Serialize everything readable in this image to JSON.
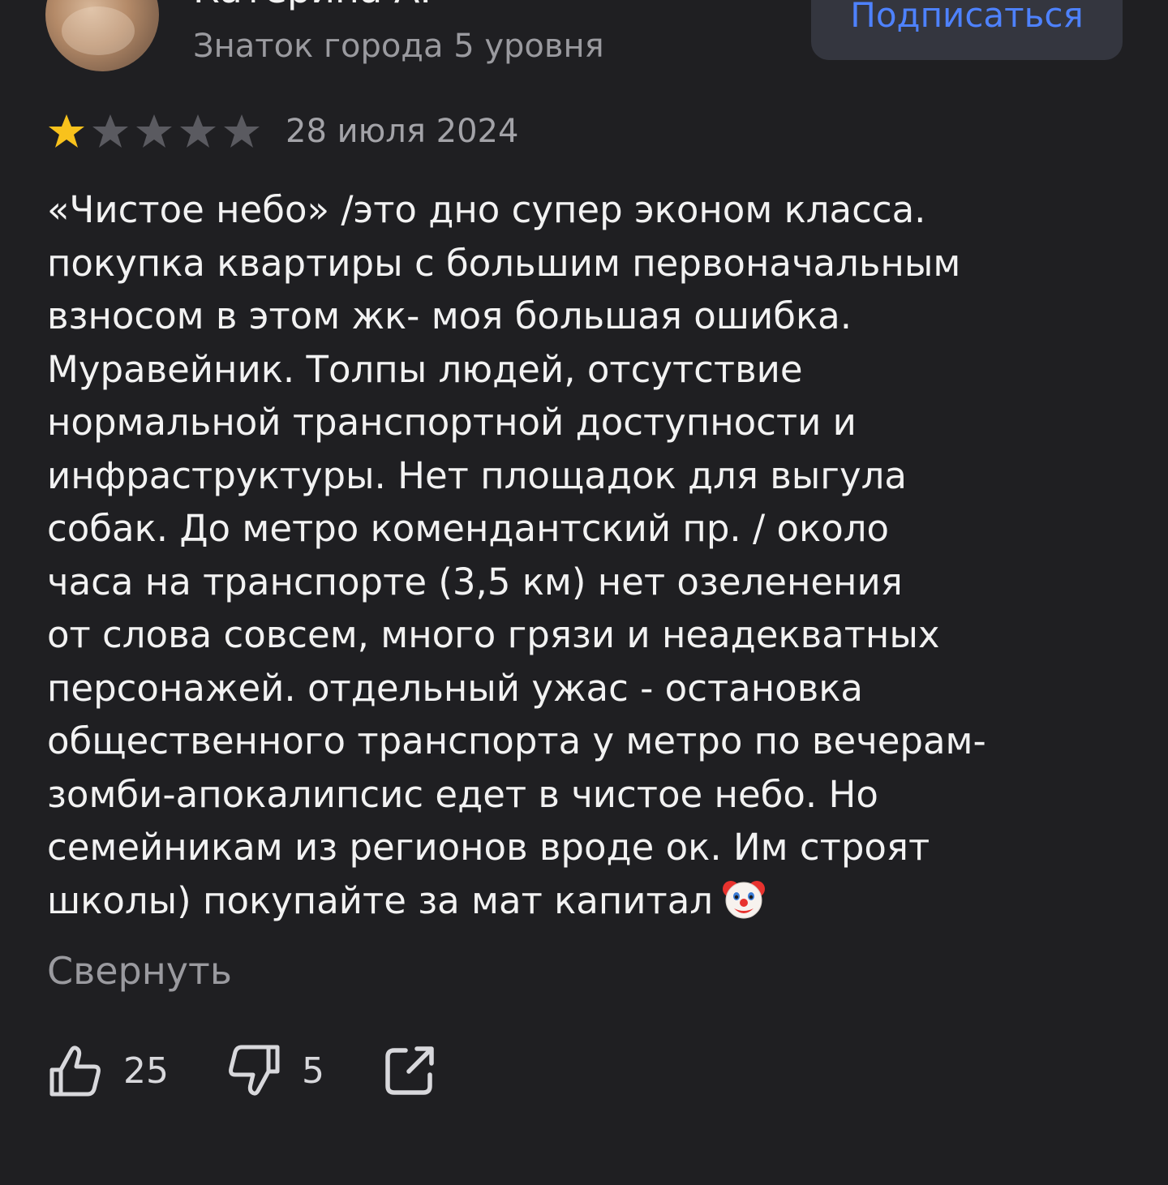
{
  "author": {
    "name": "Катерина А.",
    "level": "Знаток города 5 уровня",
    "subscribe_label": "Подписаться"
  },
  "review": {
    "rating": 1,
    "max_rating": 5,
    "date": "28 июля 2024",
    "text": "«Чистое небо» /это дно супер эконом класса.\nпокупка квартиры с большим первоначальным\nвзносом в этом жк- моя большая ошибка.\nМуравейник. Толпы людей, отсутствие\nнормальной транспортной доступности и\nинфраструктуры. Нет площадок для выгула\nсобак. До метро комендантский пр. / около\nчаса на транспорте (3,5 км) нет озеленения\nот слова совсем, много грязи и неадекватных\nперсонажей. отдельный ужас - остановка\nобщественного транспорта у метро по вечерам-\nзомби-апокалипсис едет в чистое небо. Но\nсемейникам из регионов вроде ок. Им строят\nшколы) покупайте за мат капитал",
    "emoji": "clown-face",
    "collapse_label": "Свернуть"
  },
  "actions": {
    "likes": "25",
    "dislikes": "5",
    "share_icon": "share-icon"
  },
  "colors": {
    "background": "#1f1f22",
    "accent": "#4e82ff",
    "star_filled": "#f8c21c",
    "star_empty": "#5a5a60",
    "muted_text": "#9a9a9f"
  }
}
